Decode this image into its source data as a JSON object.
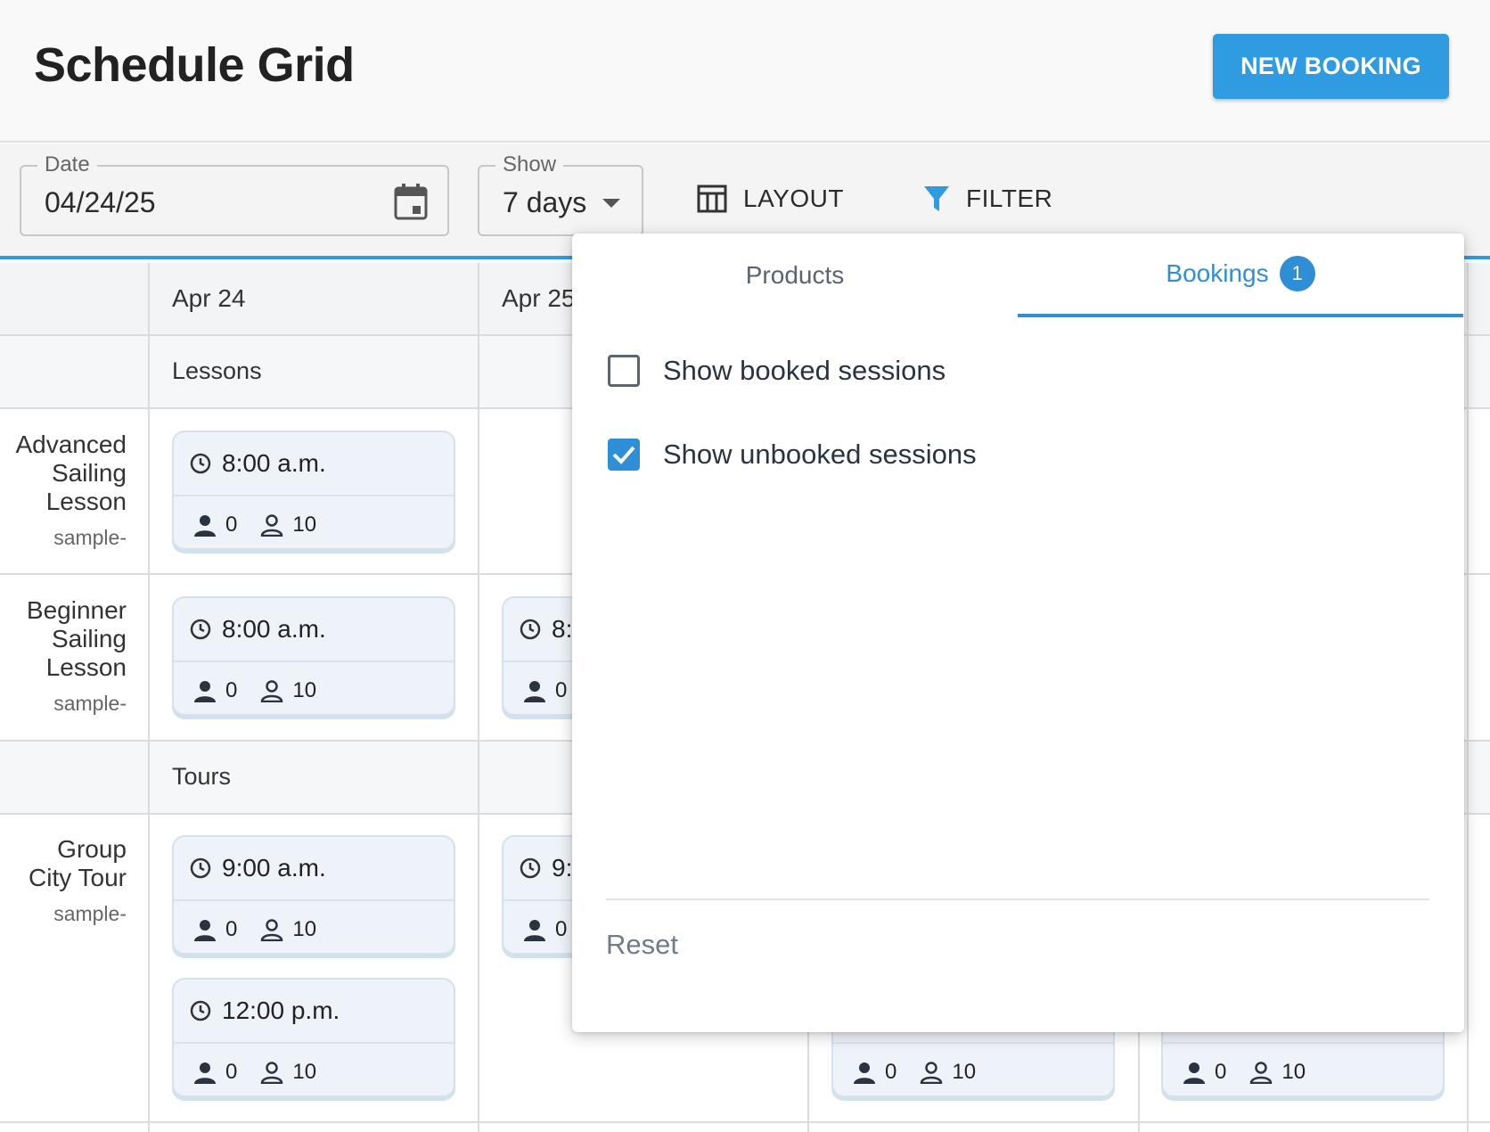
{
  "header": {
    "title": "Schedule Grid",
    "new_booking_label": "NEW BOOKING"
  },
  "toolbar": {
    "date": {
      "label": "Date",
      "value": "04/24/25"
    },
    "show": {
      "label": "Show",
      "value": "7 days"
    },
    "layout_label": "LAYOUT",
    "filter_label": "FILTER"
  },
  "grid": {
    "days": [
      "Apr 24",
      "Apr 25"
    ],
    "categories": [
      "Lessons",
      "Tours"
    ],
    "rows": [
      {
        "title": [
          "Advanced",
          "Sailing",
          "Lesson"
        ],
        "sub": "sample-"
      },
      {
        "title": [
          "Beginner",
          "Sailing",
          "Lesson"
        ],
        "sub": "sample-"
      },
      {
        "title": [
          "Group",
          "City Tour"
        ],
        "sub": "sample-"
      }
    ],
    "cards": [
      {
        "time": "8:00 a.m.",
        "booked": "0",
        "capacity": "10"
      },
      {
        "time": "8:00 a.m.",
        "booked": "0",
        "capacity": "10"
      },
      {
        "time": "8:",
        "booked": "0",
        "capacity": ""
      },
      {
        "time": "9:00 a.m.",
        "booked": "0",
        "capacity": "10"
      },
      {
        "time": "9:",
        "booked": "0",
        "capacity": ""
      },
      {
        "time": "12:00 p.m.",
        "booked": "0",
        "capacity": "10"
      },
      {
        "time": "",
        "booked": "0",
        "capacity": "10"
      },
      {
        "time": "",
        "booked": "0",
        "capacity": "10"
      }
    ]
  },
  "filter_popover": {
    "tabs": [
      {
        "label": "Products"
      },
      {
        "label": "Bookings",
        "badge": "1"
      }
    ],
    "options": [
      {
        "label": "Show booked sessions",
        "checked": false
      },
      {
        "label": "Show unbooked sessions",
        "checked": true
      }
    ],
    "reset_label": "Reset"
  },
  "colors": {
    "accent": "#2f9be1",
    "tab_active": "#2f8fd6",
    "card_bg": "#eef3f9"
  }
}
